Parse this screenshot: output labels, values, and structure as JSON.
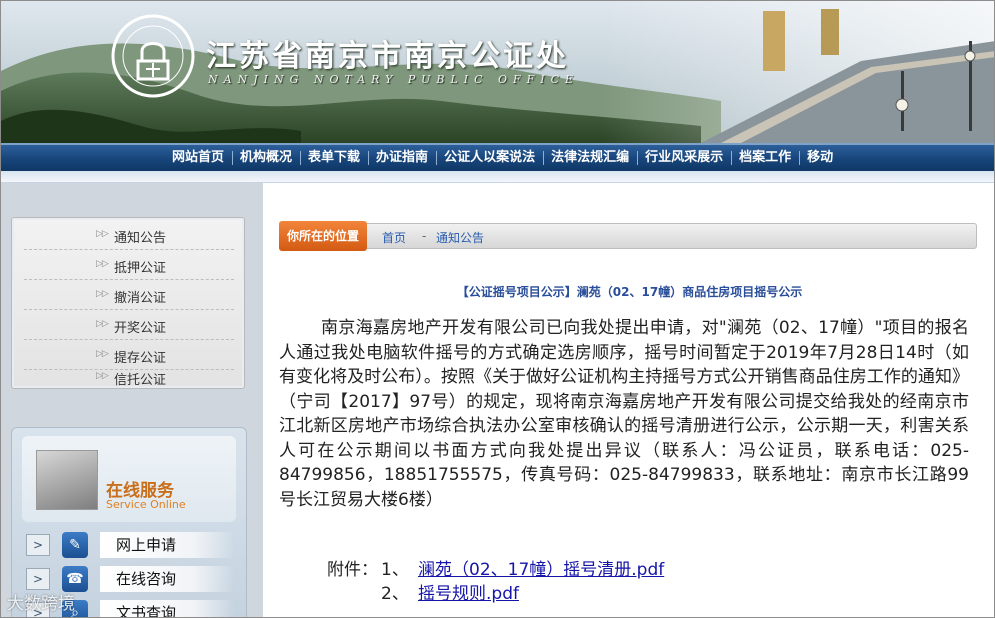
{
  "header": {
    "title": "江苏省南京市南京公证处",
    "subtitle": "NANJING NOTARY PUBLIC OFFICE",
    "seal_text": "南京公证处 · NANJING NOTARY PUBLIC OFFICE"
  },
  "nav": {
    "items": [
      "网站首页",
      "机构概况",
      "表单下载",
      "办证指南",
      "公证人以案说法",
      "法律法规汇编",
      "行业风采展示",
      "档案工作",
      "移动"
    ]
  },
  "sidebar": {
    "categories": [
      "通知公告",
      "抵押公证",
      "撤消公证",
      "开奖公证",
      "提存公证",
      "信托公证"
    ],
    "service": {
      "title": "在线服务",
      "subtitle": "Service Online",
      "buttons": [
        "网上申请",
        "在线咨询",
        "文书查询"
      ]
    }
  },
  "breadcrumb": {
    "label": "你所在的位置",
    "home": "首页",
    "separator": "-",
    "current": "通知公告"
  },
  "article": {
    "title": "【公证摇号项目公示】澜苑（02、17幢）商品住房项目摇号公示",
    "body": "南京海嘉房地产开发有限公司已向我处提出申请，对\"澜苑（02、17幢）\"项目的报名人通过我处电脑软件摇号的方式确定选房顺序，摇号时间暂定于2019年7月28日14时（如有变化将及时公布）。按照《关于做好公证机构主持摇号方式公开销售商品住房工作的通知》（宁司【2017】97号）的规定，现将南京海嘉房地产开发有限公司提交给我处的经南京市江北新区房地产市场综合执法办公室审核确认的摇号清册进行公示，公示期一天，利害关系人可在公示期间以书面方式向我处提出异议（联系人：冯公证员，联系电话：025-84799856，18851755575，传真号码：025-84799833，联系地址：南京市长江路99号长江贸易大楼6楼）",
    "attachments_label": "附件：",
    "attachments": [
      {
        "num": "1、",
        "name": "澜苑（02、17幢）摇号清册.pdf"
      },
      {
        "num": "2、",
        "name": "摇号规则.pdf"
      }
    ]
  },
  "watermark": "大数跨境",
  "colors": {
    "nav_bg": "#17457a",
    "crumb_tag": "#e06a1f",
    "title_blue": "#2a4e9a",
    "link": "#1515a8",
    "service_orange": "#c96f1b"
  }
}
